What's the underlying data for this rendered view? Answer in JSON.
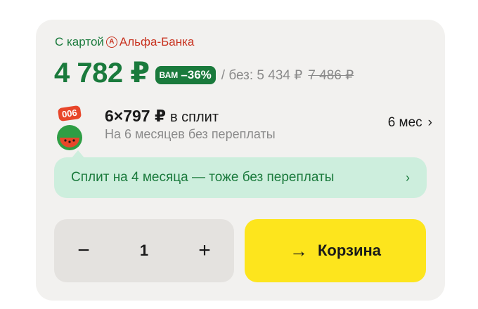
{
  "offer": {
    "card_prefix": "С картой",
    "bank_name": "Альфа-Банка",
    "bank_logo_letter": "А",
    "price": "4 782 ₽",
    "badge_you": "ВАМ",
    "badge_discount": "–36%",
    "without_label": "/ без: 5 434 ₽",
    "old_price": "7 486 ₽"
  },
  "split": {
    "icon_tag": "006",
    "amount": "6×797 ₽",
    "amount_suffix": "в сплит",
    "subtitle": "На 6 месяцев без переплаты",
    "months": "6 мес",
    "chevron": "›"
  },
  "split4": {
    "text": "Сплит на 4 месяца — тоже без переплаты",
    "chevron": "›"
  },
  "stepper": {
    "minus": "−",
    "quantity": "1",
    "plus": "+"
  },
  "cart": {
    "arrow": "→",
    "label": "Корзина"
  },
  "colors": {
    "accent_green": "#1a7a3c",
    "alfa_red": "#c8321f",
    "cart_yellow": "#fde51d",
    "split_bubble": "#cdeedd"
  }
}
